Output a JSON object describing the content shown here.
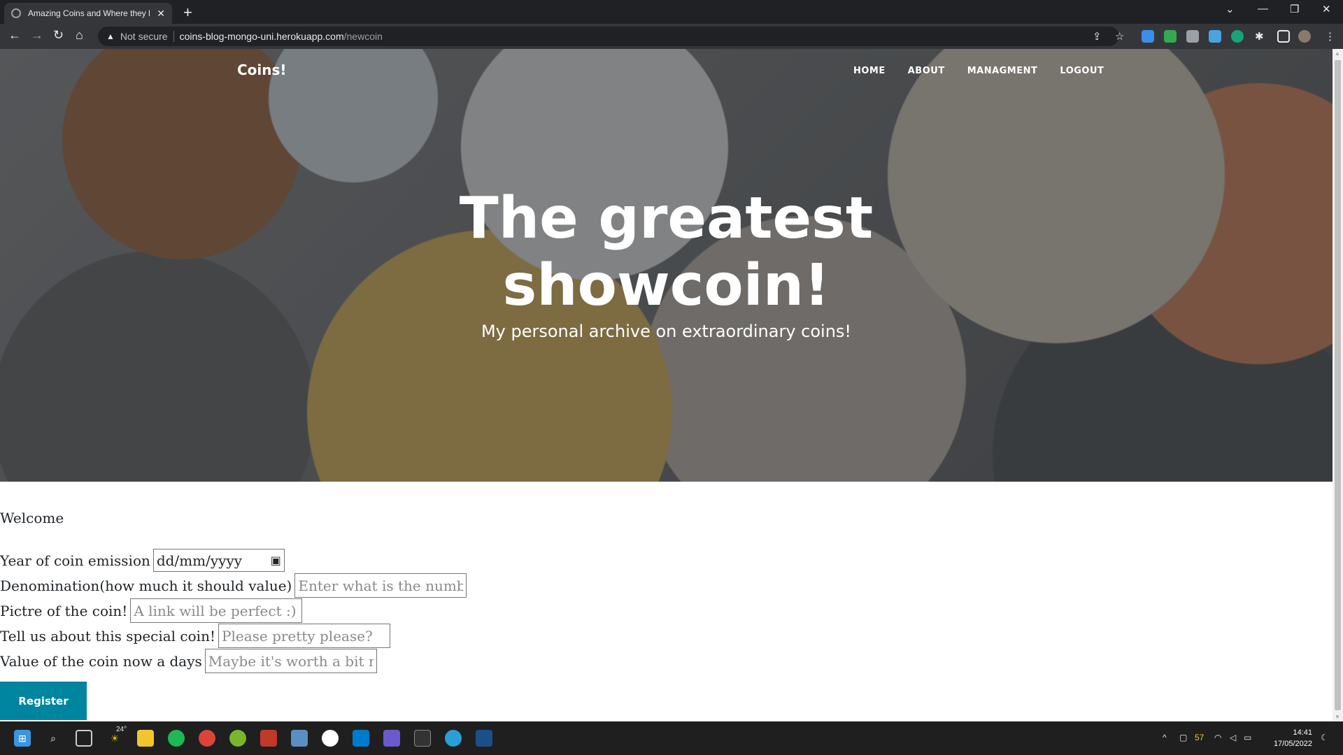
{
  "browser": {
    "tab_title": "Amazing Coins and Where they l",
    "tab_close": "✕",
    "new_tab": "+",
    "security": "Not secure",
    "url_host": "coins-blog-mongo-uni.herokuapp.com",
    "url_path": "/newcoin"
  },
  "site": {
    "brand": "Coins!",
    "nav": [
      "HOME",
      "ABOUT",
      "MANAGMENT",
      "LOGOUT"
    ],
    "hero_title_line1": "The greatest",
    "hero_title_line2": "showcoin!",
    "hero_subtitle": "My personal archive on extraordinary coins!"
  },
  "form": {
    "welcome": "Welcome",
    "year_label": "Year of coin emission",
    "year_value": "dd/mm/yyyy",
    "denomination_label": "Denomination(how much it should value)",
    "denomination_placeholder": "Enter what is the number",
    "picture_label": "Pictre of the coin!",
    "picture_placeholder": "A link will be perfect :)",
    "story_label": "Tell us about this special coin!",
    "story_placeholder": "Please pretty please?",
    "value_label": "Value of the coin now a days",
    "value_placeholder": "Maybe it's worth a bit more",
    "submit_label": "Register"
  },
  "taskbar": {
    "weather": "24°",
    "battery": "57",
    "time": "14:41",
    "date": "17/05/2022"
  },
  "colors": {
    "accent": "#0085a1"
  }
}
